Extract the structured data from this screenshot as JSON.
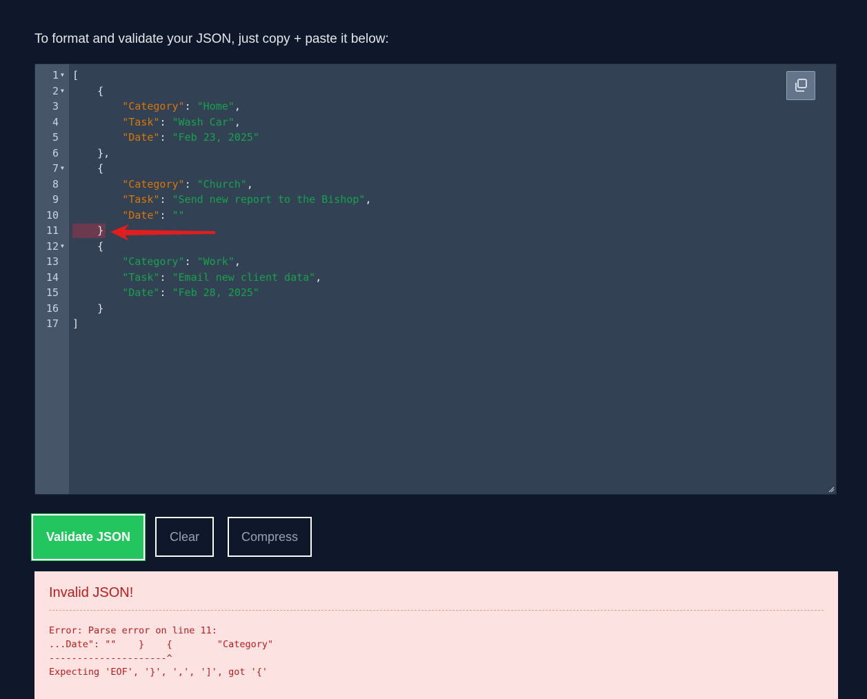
{
  "intro_text": "To format and validate your JSON, just copy + paste it below:",
  "editor": {
    "lines": [
      {
        "n": "1",
        "fold": true,
        "code": "["
      },
      {
        "n": "2",
        "fold": true,
        "code": "    {"
      },
      {
        "n": "3",
        "fold": false,
        "key": "\"Category\"",
        "val": "\"Home\"",
        "suffix": ","
      },
      {
        "n": "4",
        "fold": false,
        "key": "\"Task\"",
        "val": "\"Wash Car\"",
        "suffix": ","
      },
      {
        "n": "5",
        "fold": false,
        "key": "\"Date\"",
        "val": "\"Feb 23, 2025\"",
        "suffix": ""
      },
      {
        "n": "6",
        "fold": false,
        "code": "    },"
      },
      {
        "n": "7",
        "fold": true,
        "code": "    {"
      },
      {
        "n": "8",
        "fold": false,
        "key": "\"Category\"",
        "val": "\"Church\"",
        "suffix": ","
      },
      {
        "n": "9",
        "fold": false,
        "key": "\"Task\"",
        "val": "\"Send new report to the Bishop\"",
        "suffix": ","
      },
      {
        "n": "10",
        "fold": false,
        "key": "\"Date\"",
        "val": "\"\"",
        "suffix": ""
      },
      {
        "n": "11",
        "fold": false,
        "code": "    }",
        "error": true
      },
      {
        "n": "12",
        "fold": true,
        "code": "    {"
      },
      {
        "n": "13",
        "fold": false,
        "key": "\"Category\"",
        "val": "\"Work\"",
        "suffix": ",",
        "green_key": true
      },
      {
        "n": "14",
        "fold": false,
        "key": "\"Task\"",
        "val": "\"Email new client data\"",
        "suffix": ",",
        "green_key": true
      },
      {
        "n": "15",
        "fold": false,
        "key": "\"Date\"",
        "val": "\"Feb 28, 2025\"",
        "suffix": "",
        "green_key": true
      },
      {
        "n": "16",
        "fold": false,
        "code": "    }"
      },
      {
        "n": "17",
        "fold": false,
        "code": "]"
      }
    ]
  },
  "buttons": {
    "validate": "Validate JSON",
    "clear": "Clear",
    "compress": "Compress"
  },
  "error": {
    "title": "Invalid JSON!",
    "body": "Error: Parse error on line 11:\n...Date\": \"\"    }    {        \"Category\"\n---------------------^\nExpecting 'EOF', '}', ',', ']', got '{'"
  },
  "colors": {
    "background": "#0f172a",
    "editor_bg": "#334155",
    "gutter_bg": "#475569",
    "key": "#d97706",
    "string": "#16a34a",
    "validate_btn": "#22c55e",
    "error_bg": "#fde2e2",
    "error_text": "#b91c1c",
    "arrow": "#e11d1d"
  },
  "icons": {
    "copy": "copy-icon",
    "arrow": "red-arrow-annotation"
  }
}
